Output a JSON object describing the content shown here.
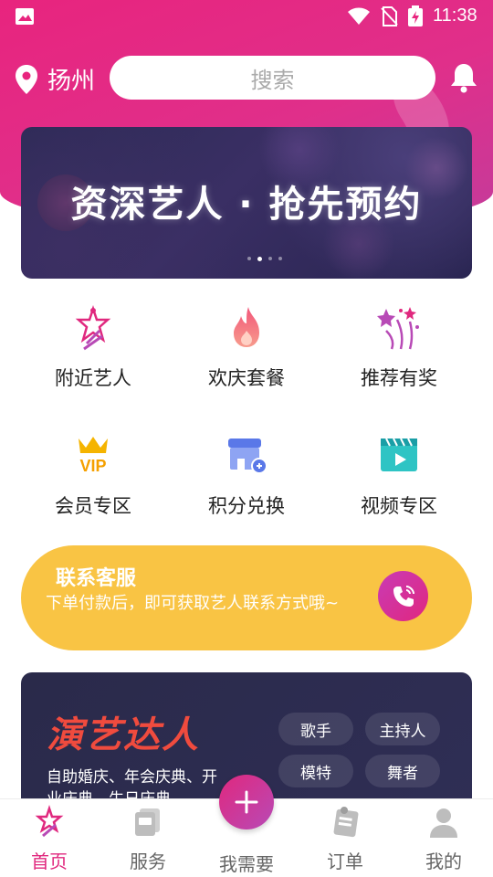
{
  "status_bar": {
    "time": "11:38"
  },
  "header": {
    "city": "扬州",
    "search_placeholder": "搜索"
  },
  "banner": {
    "title": "资深艺人 · 抢先预约",
    "dot_count": 4,
    "active_dot": 1
  },
  "grid": [
    {
      "label": "附近艺人",
      "icon": "star-performer-icon"
    },
    {
      "label": "欢庆套餐",
      "icon": "flame-icon"
    },
    {
      "label": "推荐有奖",
      "icon": "fireworks-icon"
    },
    {
      "label": "会员专区",
      "icon": "vip-crown-icon"
    },
    {
      "label": "积分兑换",
      "icon": "shop-icon"
    },
    {
      "label": "视频专区",
      "icon": "video-icon"
    }
  ],
  "contact": {
    "title": "联系客服",
    "desc": "下单付款后，即可获取艺人联系方式哦~"
  },
  "talent": {
    "title": "演艺达人",
    "subtitle": "自助婚庆、年会庆典、开业庆典、生日庆典",
    "tags": [
      "歌手",
      "主持人",
      "模特",
      "舞者"
    ]
  },
  "bottom_nav": {
    "items": [
      {
        "label": "首页",
        "icon": "home-star-icon",
        "active": true
      },
      {
        "label": "服务",
        "icon": "services-icon",
        "active": false
      },
      {
        "label": "我需要",
        "icon": "plus-icon",
        "active": false
      },
      {
        "label": "订单",
        "icon": "orders-icon",
        "active": false
      },
      {
        "label": "我的",
        "icon": "profile-icon",
        "active": false
      }
    ]
  },
  "colors": {
    "brand_pink": "#e0287e",
    "contact_yellow": "#f9c444",
    "banner_dark": "#2c2a55"
  }
}
